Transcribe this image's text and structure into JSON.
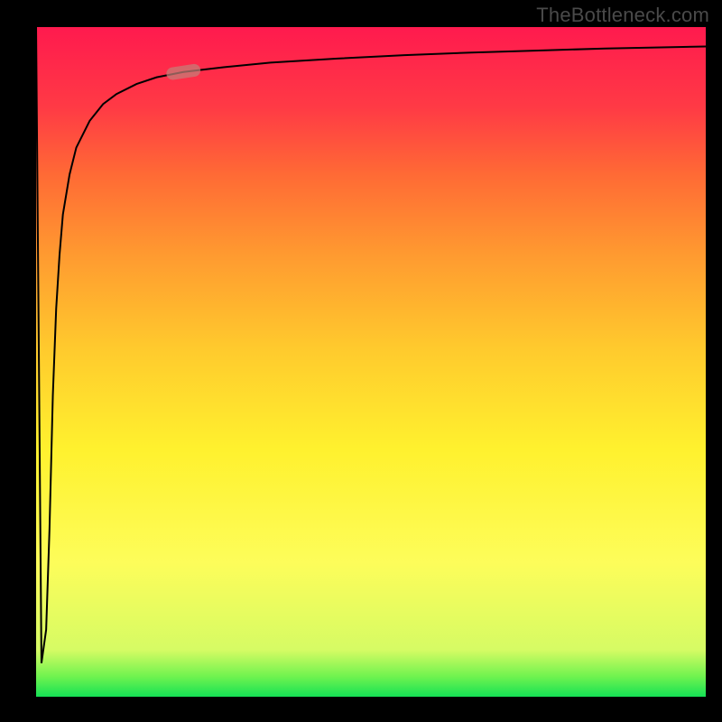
{
  "watermark": "TheBottleneck.com",
  "accent_colors": {
    "gradient_top": "#ff1a4e",
    "gradient_bottom": "#15e155",
    "curve": "#000000",
    "marker": "#c47f78"
  },
  "chart_data": {
    "type": "line",
    "title": "",
    "xlabel": "",
    "ylabel": "",
    "xlim": [
      0,
      100
    ],
    "ylim": [
      0,
      100
    ],
    "grid": false,
    "legend": false,
    "series": [
      {
        "name": "bottleneck-curve",
        "x": [
          0,
          0.8,
          1.5,
          2,
          2.5,
          3,
          3.5,
          4,
          5,
          6,
          8,
          10,
          12,
          15,
          18,
          22,
          28,
          35,
          45,
          55,
          65,
          75,
          85,
          95,
          100
        ],
        "y": [
          100,
          5,
          10,
          25,
          45,
          58,
          66,
          72,
          78,
          82,
          86,
          88.5,
          90,
          91.5,
          92.5,
          93.3,
          94,
          94.7,
          95.3,
          95.8,
          96.2,
          96.5,
          96.8,
          97,
          97.1
        ]
      }
    ],
    "annotations": [
      {
        "name": "highlight-marker",
        "x": 22,
        "y": 93.3
      }
    ]
  }
}
